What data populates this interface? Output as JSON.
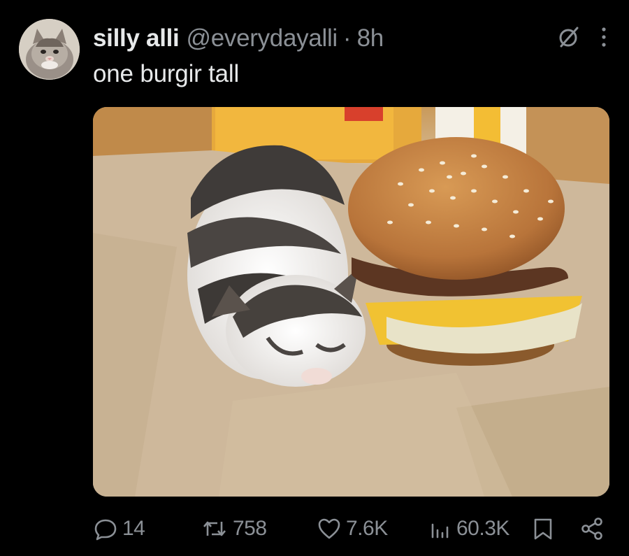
{
  "tweet": {
    "author": {
      "display_name": "silly alli",
      "handle": "@everydayalli",
      "avatar_icon": "kitten-avatar"
    },
    "separator": "·",
    "timestamp": "8h",
    "text": "one burgir tall",
    "media": {
      "image_icon": "kitten-next-to-burger-photo"
    },
    "header_icons": [
      "grok-icon",
      "more-options-icon"
    ],
    "stats": {
      "replies": "14",
      "reposts": "758",
      "likes": "7.6K",
      "views": "60.3K"
    }
  },
  "colors": {
    "background": "#000000",
    "primary_text": "#e7e9ea",
    "secondary_text": "#8b9096"
  }
}
